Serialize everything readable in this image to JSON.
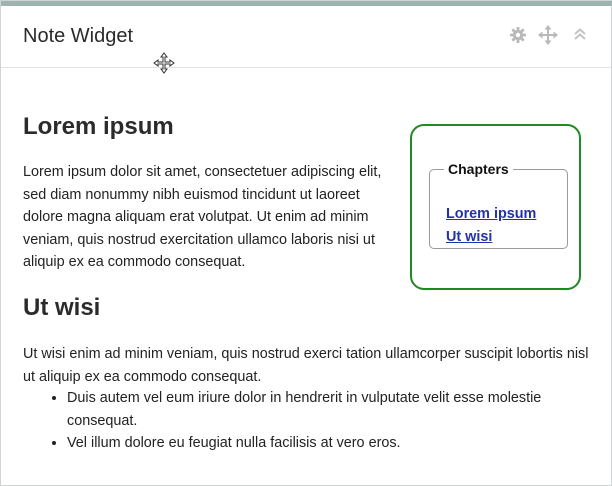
{
  "widget": {
    "title": "Note Widget",
    "icons": {
      "settings": "gear-icon",
      "move": "move-icon",
      "collapse": "collapse-icon",
      "cursor": "move-cursor-icon"
    }
  },
  "article": {
    "section1": {
      "heading": "Lorem ipsum",
      "paragraph": "Lorem ipsum dolor sit amet, consectetuer adipiscing elit, sed diam nonummy nibh euismod tincidunt ut laoreet dolore magna aliquam erat volutpat. Ut enim ad minim veniam, quis nostrud exercitation ullamco laboris nisi ut aliquip ex ea commodo consequat."
    },
    "section2": {
      "heading": "Ut wisi",
      "paragraph": "Ut wisi enim ad minim veniam, quis nostrud exerci tation ullamcorper suscipit lobortis nisl ut aliquip ex ea commodo consequat.",
      "bullets": [
        "Duis autem vel eum iriure dolor in hendrerit in vulputate velit esse molestie consequat.",
        "Vel illum dolore eu feugiat nulla facilisis at vero eros."
      ]
    }
  },
  "chapters": {
    "legend": "Chapters",
    "links": [
      "Lorem ipsum",
      "Ut wisi"
    ],
    "border_color": "#1f8a1f",
    "link_color": "#2233aa"
  },
  "colors": {
    "topbar": "#9fb4b0"
  }
}
